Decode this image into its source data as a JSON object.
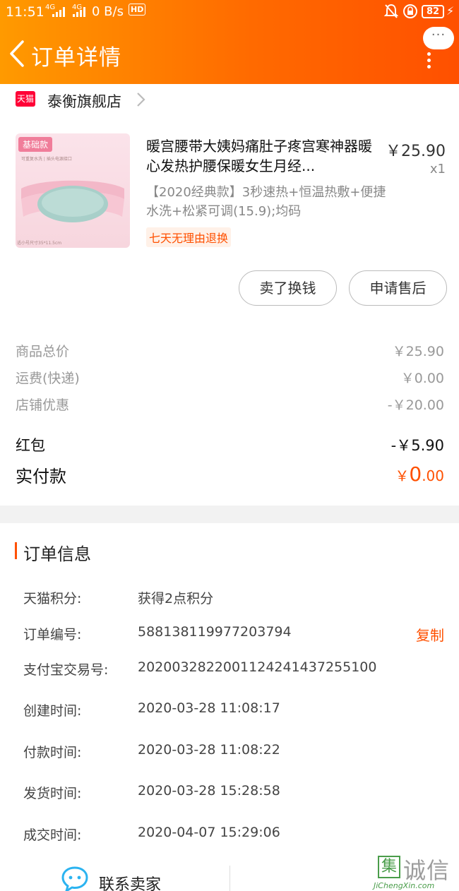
{
  "status_bar": {
    "time": "11:51",
    "network_1": "4G",
    "network_2": "4G",
    "speed": "0 B/s",
    "hd": "HD",
    "battery": "82"
  },
  "header": {
    "title": "订单详情",
    "more_bubble": "···"
  },
  "shop": {
    "logo_text": "天猫",
    "name": "泰衡旗舰店"
  },
  "product": {
    "thumb_tag": "基础款",
    "thumb_caption": "可重复水洗 | 插头电源接口",
    "thumb_size": "适小号尺寸35*11.5cm",
    "title": "暖宫腰带大姨妈痛肚子疼宫寒神器暖心发热护腰保暖女生月经...",
    "price": "￥25.90",
    "quantity": "x1",
    "sku": "【2020经典款】3秒速热+恒温热敷+便捷水洗+松紧可调(15.9);均码",
    "return_tag": "七天无理由退换"
  },
  "actions": {
    "sell_label": "卖了换钱",
    "aftersale_label": "申请售后"
  },
  "price_summary": {
    "items": [
      {
        "label": "商品总价",
        "value": "￥25.90"
      },
      {
        "label": "运费(快递)",
        "value": "￥0.00"
      },
      {
        "label": "店铺优惠",
        "value": "-￥20.00"
      }
    ],
    "red_packet_label": "红包",
    "red_packet_value": "-￥5.90",
    "paid_label": "实付款",
    "paid_currency": "￥",
    "paid_int": "0",
    "paid_dec": ".00"
  },
  "order_info": {
    "heading": "订单信息",
    "rows": [
      {
        "label": "天猫积分:",
        "value": "获得2点积分"
      },
      {
        "label": "订单编号:",
        "value": "588138119977203794"
      },
      {
        "label": "支付宝交易号:",
        "value": "2020032822001124241437255100"
      },
      {
        "label": "创建时间:",
        "value": "2020-03-28 11:08:17"
      },
      {
        "label": "付款时间:",
        "value": "2020-03-28 11:08:22"
      },
      {
        "label": "发货时间:",
        "value": "2020-03-28 15:28:58"
      },
      {
        "label": "成交时间:",
        "value": "2020-04-07 15:29:06"
      }
    ],
    "copy_label": "复制"
  },
  "footer": {
    "contact_label": "联系卖家"
  },
  "watermark": {
    "logo": "集",
    "text": "诚信",
    "url": "JiChengXin.com"
  },
  "colors": {
    "accent": "#ff5000",
    "header_start": "#ff9a00",
    "tmall_red": "#ff0036"
  }
}
